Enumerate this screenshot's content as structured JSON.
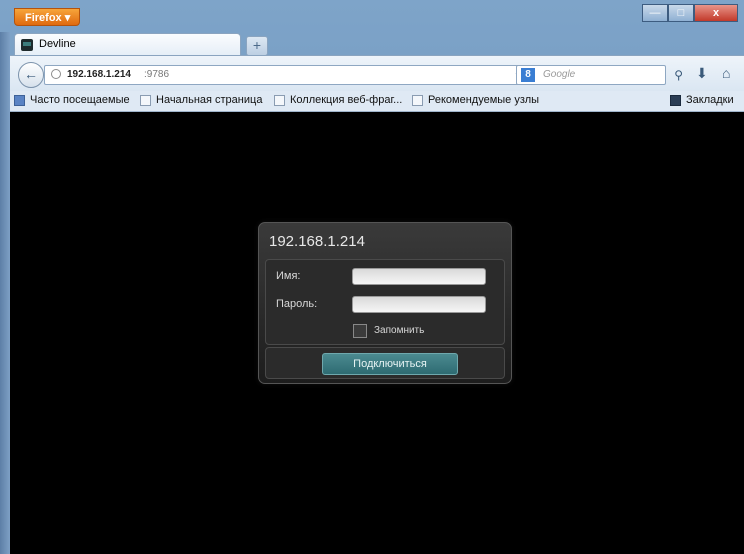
{
  "browser": {
    "menu_button": "Firefox ▾",
    "window_controls": {
      "minimize": "—",
      "maximize": "□",
      "close": "x"
    },
    "tab": {
      "title": "Devline"
    },
    "new_tab": "+",
    "address": {
      "host": "192.168.1.214",
      "port": ":9786"
    },
    "search": {
      "engine_icon": "8",
      "placeholder": "Google"
    },
    "bookmarks": [
      {
        "label": "Часто посещаемые"
      },
      {
        "label": "Начальная страница"
      },
      {
        "label": "Коллекция веб-фраг..."
      },
      {
        "label": "Рекомендуемые узлы"
      }
    ],
    "bookmarks_menu": "Закладки"
  },
  "login": {
    "title": "192.168.1.214",
    "name_label": "Имя:",
    "password_label": "Пароль:",
    "remember_label": "Запомнить",
    "connect_button": "Подключиться"
  },
  "colors": {
    "accent": "#2e6b72",
    "background": "#000000",
    "firefox": "#e06a10"
  }
}
